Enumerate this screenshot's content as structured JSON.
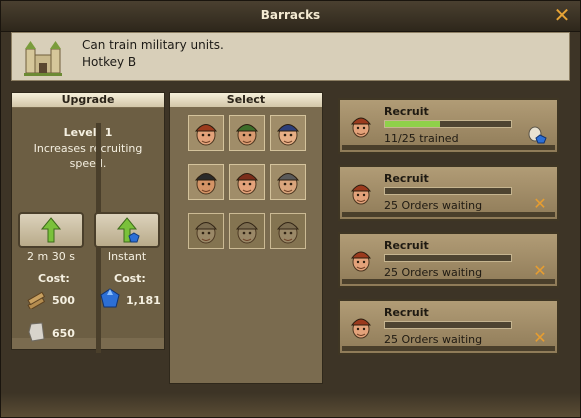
{
  "window": {
    "title": "Barracks"
  },
  "info": {
    "description": "Can train military units.",
    "hotkey": "Hotkey B",
    "icon": "barracks-building-icon"
  },
  "upgrade": {
    "header": "Upgrade",
    "level_label": "Level: 1",
    "effect_line1": "Increases recruiting",
    "effect_line2": "speed.",
    "timed_label": "2 m 30 s",
    "instant_label": "Instant",
    "cost_label_left": "Cost:",
    "cost_label_right": "Cost:",
    "wood_cost": "500",
    "stone_cost": "650",
    "gem_cost": "1,181"
  },
  "select": {
    "header": "Select",
    "units": [
      {
        "name": "unit-spearman-icon",
        "locked": false
      },
      {
        "name": "unit-archer-icon",
        "locked": false
      },
      {
        "name": "unit-crossbowman-icon",
        "locked": false
      },
      {
        "name": "unit-rogue-icon",
        "locked": false
      },
      {
        "name": "unit-swordsman-icon",
        "locked": false
      },
      {
        "name": "unit-knight-icon",
        "locked": false
      },
      {
        "name": "unit-locked-1-icon",
        "locked": true
      },
      {
        "name": "unit-locked-2-icon",
        "locked": true
      },
      {
        "name": "unit-locked-3-icon",
        "locked": true
      }
    ]
  },
  "queue": [
    {
      "title": "Recruit",
      "status": "11/25 trained",
      "progress": 0.44,
      "action": "speedup"
    },
    {
      "title": "Recruit",
      "status": "25 Orders waiting",
      "progress": 0.0,
      "action": "cancel"
    },
    {
      "title": "Recruit",
      "status": "25 Orders waiting",
      "progress": 0.0,
      "action": "cancel"
    },
    {
      "title": "Recruit",
      "status": "25 Orders waiting",
      "progress": 0.0,
      "action": "cancel"
    }
  ],
  "colors": {
    "progress_fill": "#8fd14a",
    "cancel": "#e79d30",
    "accent_green": "#7ac13b",
    "gem_blue": "#2c6fd6"
  }
}
